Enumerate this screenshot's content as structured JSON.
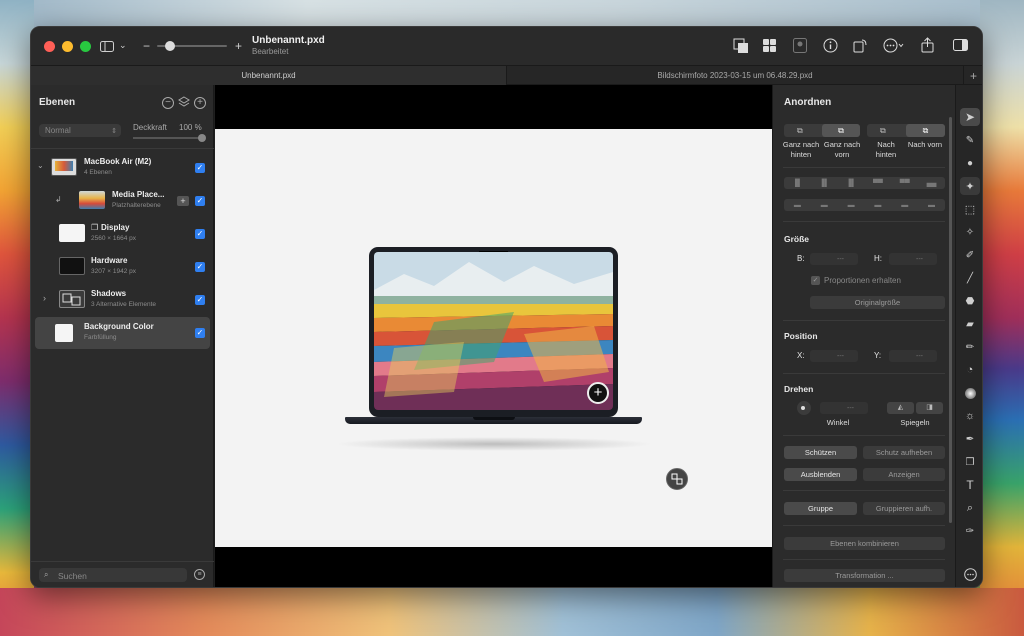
{
  "window": {
    "title": "Unbenannt.pxd",
    "subtitle": "Bearbeitet"
  },
  "tabs": [
    "Unbenannt.pxd",
    "Bildschirmfoto 2023-03-15 um 06.48.29.pxd"
  ],
  "tab_add": "+",
  "layers_panel": {
    "title": "Ebenen",
    "blend_mode": "Normal",
    "opacity_label": "Deckkraft",
    "opacity_value": "100 %",
    "search_placeholder": "Suchen",
    "layers": [
      {
        "name": "MacBook Air (M2)",
        "sub": "4 Ebenen"
      },
      {
        "name": "Media Place...",
        "sub": "Platzhalterebene"
      },
      {
        "name": "Display",
        "sub": "2560 × 1664 px"
      },
      {
        "name": "Hardware",
        "sub": "3207 × 1942 px"
      },
      {
        "name": "Shadows",
        "sub": "3 Alternative Elemente"
      },
      {
        "name": "Background Color",
        "sub": "Farbfüllung"
      }
    ]
  },
  "arrange_panel": {
    "title": "Anordnen",
    "order_labels": [
      "Ganz nach hinten",
      "Ganz nach vorn",
      "Nach hinten",
      "Nach vorn"
    ],
    "size_title": "Größe",
    "w_label": "B:",
    "h_label": "H:",
    "placeholder": "---",
    "proportions": "Proportionen erhalten",
    "original_size": "Originalgröße",
    "position_title": "Position",
    "x_label": "X:",
    "y_label": "Y:",
    "rotate_title": "Drehen",
    "angle_label": "Winkel",
    "mirror_label": "Spiegeln",
    "lock": "Schützen",
    "unlock": "Schutz aufheben",
    "hide": "Ausblenden",
    "show": "Anzeigen",
    "group": "Gruppe",
    "ungroup": "Gruppieren aufh.",
    "combine": "Ebenen kombinieren",
    "transform": "Transformation ..."
  },
  "toolbar": {
    "text_tool": "T"
  },
  "canvas": {
    "badge": "+"
  },
  "colors": {
    "accent": "#2f7ff0",
    "window_bg": "#1f1f1f",
    "panel_bg": "#2b2b2b"
  }
}
